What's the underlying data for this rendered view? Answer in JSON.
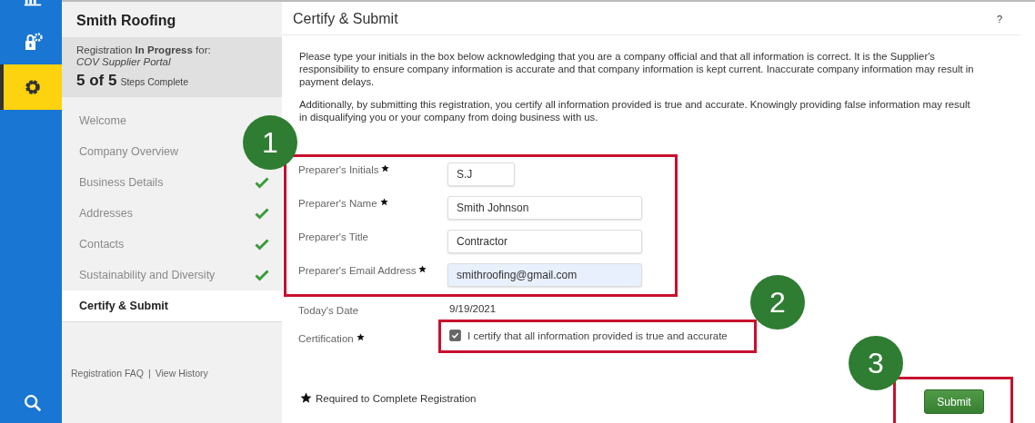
{
  "rail_items": [
    {
      "kind": "chart",
      "selected": false
    },
    {
      "kind": "lock-gear",
      "selected": false
    },
    {
      "kind": "gear",
      "selected": true
    },
    {
      "kind": "search",
      "selected": false
    }
  ],
  "sidebar": {
    "company": "Smith Roofing",
    "status_line": "Registration **In Progress** for:",
    "portal": "COV Supplier Portal",
    "progress_count": "5 of 5",
    "progress_label": "Steps Complete",
    "steps": [
      {
        "label": "Welcome",
        "completed": false,
        "selected": false
      },
      {
        "label": "Company Overview",
        "completed": false,
        "selected": false
      },
      {
        "label": "Business Details",
        "completed": true,
        "selected": false
      },
      {
        "label": "Addresses",
        "completed": true,
        "selected": false
      },
      {
        "label": "Contacts",
        "completed": true,
        "selected": false
      },
      {
        "label": "Sustainability and Diversity",
        "completed": true,
        "selected": false
      },
      {
        "label": "Certify & Submit",
        "completed": false,
        "selected": true
      }
    ],
    "links": [
      "Registration FAQ",
      "View History"
    ],
    "link_separator": "|"
  },
  "panel": {
    "title": "Certify & Submit",
    "help": "?",
    "paragraphs": [
      "Please type your initials in the box below acknowledging that you are a company official and that all information is correct. It is the Supplier's responsibility to ensure company information is accurate and that company information is kept current. Inaccurate company information may result in payment delays.",
      "Additionally, by submitting this registration, you certify all information provided is true and accurate. Knowingly providing false information may result in disqualifying you or your company from doing business with us."
    ],
    "fields": [
      {
        "label": "Preparer's Initials",
        "required": true,
        "value": "S.J",
        "autofilled": false
      },
      {
        "label": "Preparer's Name",
        "required": true,
        "value": "Smith Johnson",
        "autofilled": false
      },
      {
        "label": "Preparer's Title",
        "required": false,
        "value": "Contractor",
        "autofilled": false
      },
      {
        "label": "Preparer's Email Address",
        "required": true,
        "value": "smithroofing@gmail.com",
        "autofilled": true
      }
    ],
    "date": {
      "label": "Today's Date",
      "value": "9/19/2021"
    },
    "certification": {
      "label": "Certification",
      "required": true,
      "checked": true,
      "text": "I certify that all information provided is true and accurate"
    },
    "legend": "Required to Complete Registration",
    "submit": "Submit"
  },
  "annotations": [
    {
      "number": "1"
    },
    {
      "number": "2"
    },
    {
      "number": "3"
    }
  ]
}
